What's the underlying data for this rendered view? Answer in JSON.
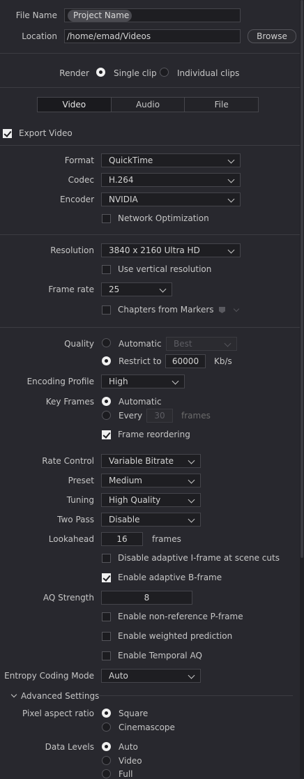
{
  "file": {
    "file_name_label": "File Name",
    "file_name_value": "Project Name",
    "location_label": "Location",
    "location_value": "/home/emad/Videos",
    "browse_label": "Browse"
  },
  "render": {
    "label": "Render",
    "single_clip": "Single clip",
    "individual_clips": "Individual clips",
    "selected": "single_clip"
  },
  "tabs": [
    {
      "label": "Video",
      "active": true
    },
    {
      "label": "Audio",
      "active": false
    },
    {
      "label": "File",
      "active": false
    }
  ],
  "export_video": {
    "label": "Export Video",
    "checked": true
  },
  "format": {
    "label": "Format",
    "value": "QuickTime"
  },
  "codec": {
    "label": "Codec",
    "value": "H.264"
  },
  "encoder": {
    "label": "Encoder",
    "value": "NVIDIA"
  },
  "network_optimization": {
    "label": "Network Optimization",
    "checked": false
  },
  "resolution": {
    "label": "Resolution",
    "value": "3840 x 2160 Ultra HD"
  },
  "vertical_resolution": {
    "label": "Use vertical resolution",
    "checked": false
  },
  "frame_rate": {
    "label": "Frame rate",
    "value": "25"
  },
  "chapters": {
    "label": "Chapters from Markers",
    "checked": false
  },
  "quality": {
    "label": "Quality",
    "automatic": "Automatic",
    "automatic_value": "Best",
    "restrict_to": "Restrict to",
    "restrict_value": "60000",
    "unit": "Kb/s",
    "selected": "restrict_to"
  },
  "encoding_profile": {
    "label": "Encoding Profile",
    "value": "High"
  },
  "key_frames": {
    "label": "Key Frames",
    "automatic": "Automatic",
    "every": "Every",
    "every_value": "30",
    "frames_unit": "frames",
    "selected": "automatic"
  },
  "frame_reordering": {
    "label": "Frame reordering",
    "checked": true
  },
  "rate_control": {
    "label": "Rate Control",
    "value": "Variable Bitrate"
  },
  "preset": {
    "label": "Preset",
    "value": "Medium"
  },
  "tuning": {
    "label": "Tuning",
    "value": "High Quality"
  },
  "two_pass": {
    "label": "Two Pass",
    "value": "Disable"
  },
  "lookahead": {
    "label": "Lookahead",
    "value": "16",
    "unit": "frames"
  },
  "disable_adaptive_i": {
    "label": "Disable adaptive I-frame at scene cuts",
    "checked": false
  },
  "enable_adaptive_b": {
    "label": "Enable adaptive B-frame",
    "checked": true
  },
  "aq_strength": {
    "label": "AQ Strength",
    "value": "8"
  },
  "non_reference_p": {
    "label": "Enable non-reference P-frame",
    "checked": false
  },
  "weighted_prediction": {
    "label": "Enable weighted prediction",
    "checked": false
  },
  "temporal_aq": {
    "label": "Enable Temporal AQ",
    "checked": false
  },
  "entropy": {
    "label": "Entropy Coding Mode",
    "value": "Auto"
  },
  "advanced": {
    "label": "Advanced Settings"
  },
  "pixel_aspect": {
    "label": "Pixel aspect ratio",
    "square": "Square",
    "cinemascope": "Cinemascope",
    "selected": "square"
  },
  "data_levels": {
    "label": "Data Levels",
    "auto": "Auto",
    "video": "Video",
    "full": "Full",
    "selected": "auto"
  },
  "colors": {
    "background": "#28282e",
    "field": "#1e1e22",
    "text": "#c6c6c6"
  }
}
